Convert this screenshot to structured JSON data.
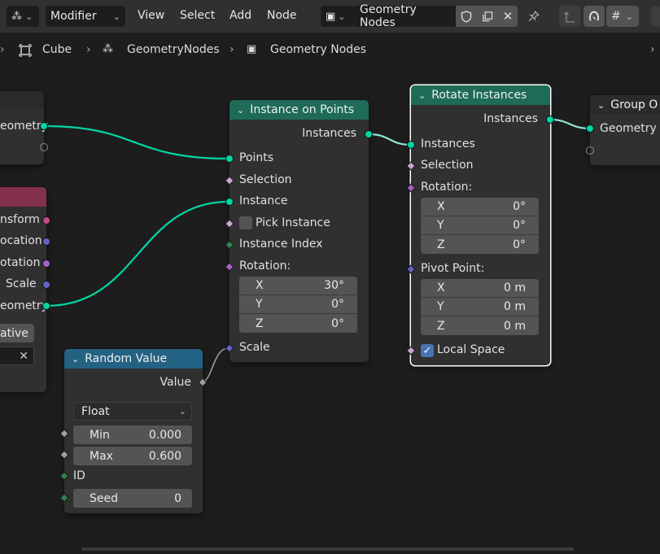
{
  "header": {
    "editor_type_icon": "node-editor-icon",
    "modifier_dropdown": "Modifier",
    "menus": [
      "View",
      "Select",
      "Add",
      "Node"
    ],
    "node_tree_name": "Geometry Nodes",
    "icons": [
      "shield-icon",
      "duplicate-icon",
      "close-icon",
      "pin-icon",
      "parent-arrow-icon",
      "snap-magnet-icon",
      "grid-snap-icon"
    ]
  },
  "breadcrumb": {
    "object": "Cube",
    "modifier": "GeometryNodes",
    "tree": "Geometry Nodes"
  },
  "colors": {
    "geometry_socket": "#00d6a3",
    "vector_socket": "#6363c7",
    "rotation_socket": "#a663c7",
    "integer_socket": "#35824f",
    "float_socket": "#a1a1a1",
    "boolean_socket": "#cca6d6",
    "matrix_socket": "#c24c8a",
    "geometry_header": "#1e6b58",
    "utility_header": "#246283",
    "input_header": "#83314a",
    "checkbox_on": "#4772b3"
  },
  "left_partial_node": {
    "output_label": "eometry"
  },
  "transform_partial_node": {
    "outputs": [
      "nsform",
      "ocation",
      "otation",
      "Scale",
      "eometry"
    ],
    "button": "ative"
  },
  "instance_on_points": {
    "title": "Instance on Points",
    "output": "Instances",
    "inputs": [
      "Points",
      "Selection",
      "Instance",
      "Pick Instance",
      "Instance Index",
      "Rotation:",
      "Scale"
    ],
    "rotation": {
      "x_label": "X",
      "x": "30°",
      "y_label": "Y",
      "y": "0°",
      "z_label": "Z",
      "z": "0°"
    },
    "pick_instance_checked": false
  },
  "rotate_instances": {
    "title": "Rotate Instances",
    "output": "Instances",
    "inputs": [
      "Instances",
      "Selection",
      "Rotation:",
      "Pivot Point:",
      "Local Space"
    ],
    "rotation": {
      "x_label": "X",
      "x": "0°",
      "y_label": "Y",
      "y": "0°",
      "z_label": "Z",
      "z": "0°"
    },
    "pivot": {
      "x_label": "X",
      "x": "0 m",
      "y_label": "Y",
      "y": "0 m",
      "z_label": "Z",
      "z": "0 m"
    },
    "local_space_checked": true
  },
  "group_output": {
    "title": "Group O",
    "input": "Geometry"
  },
  "random_value": {
    "title": "Random Value",
    "output": "Value",
    "data_type": "Float",
    "min_label": "Min",
    "min": "0.000",
    "max_label": "Max",
    "max": "0.600",
    "id_label": "ID",
    "seed_label": "Seed",
    "seed": "0"
  }
}
